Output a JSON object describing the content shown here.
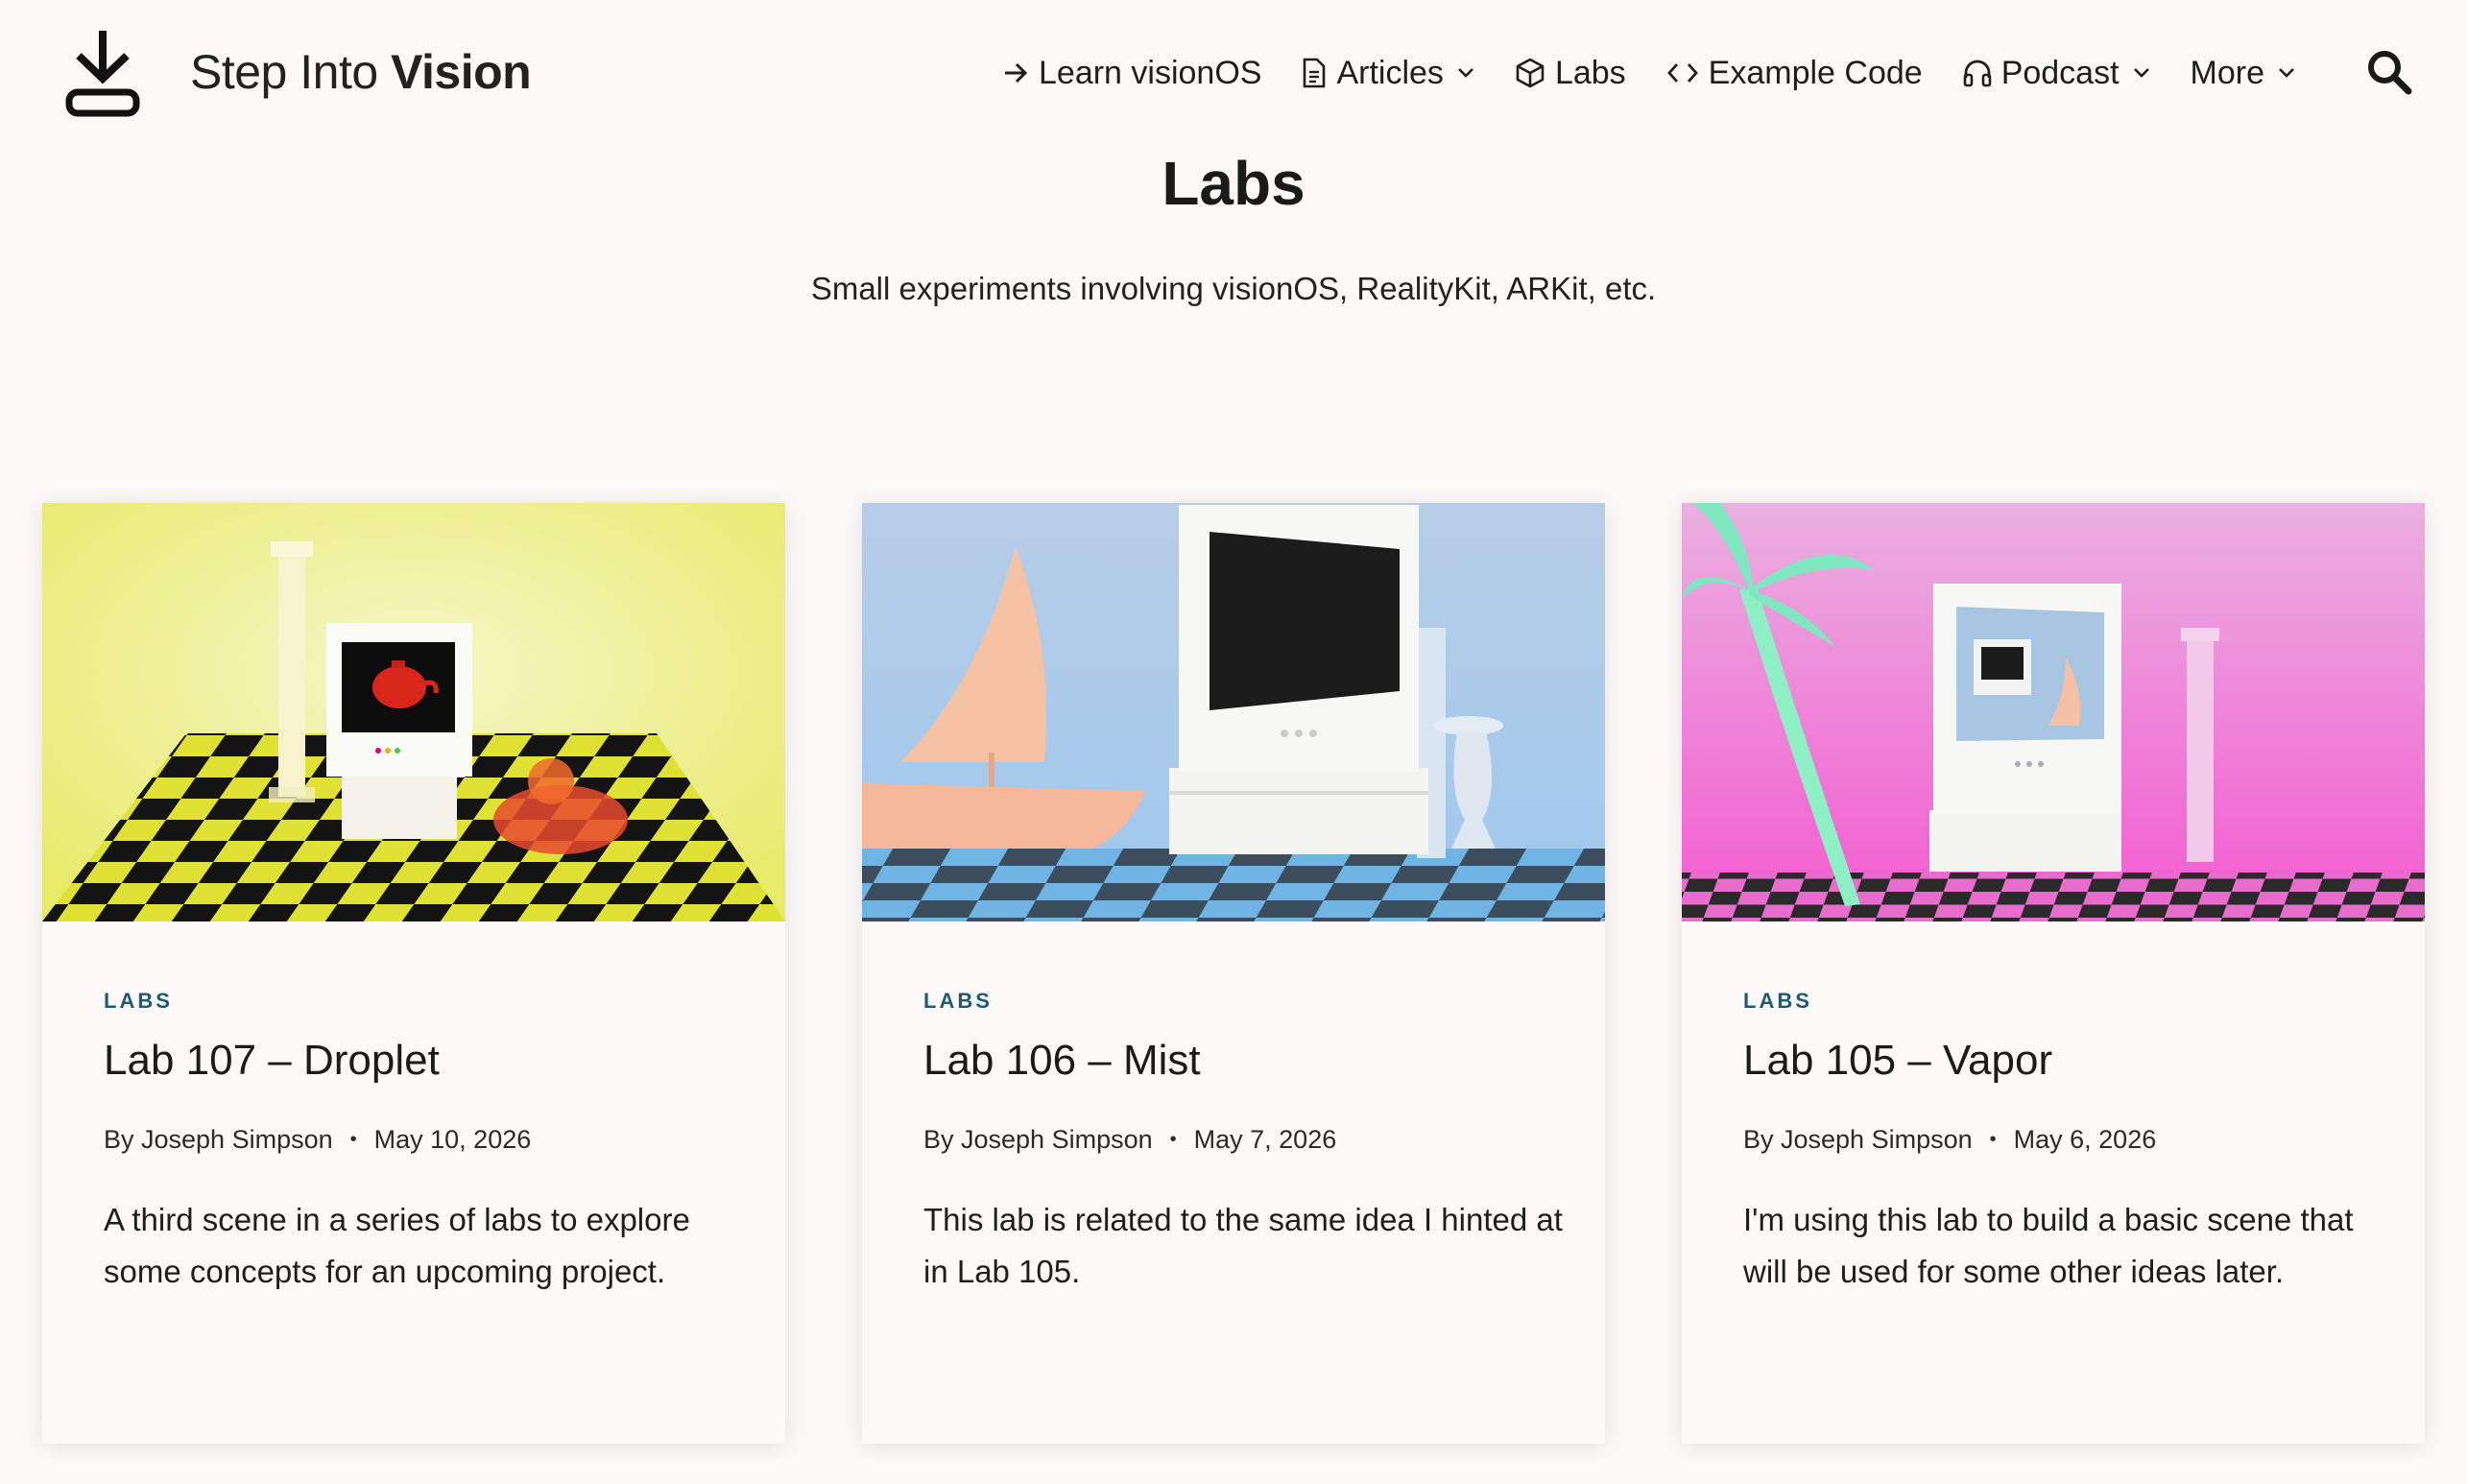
{
  "header": {
    "brand_light": "Step Into",
    "brand_bold": "Vision",
    "nav": [
      {
        "label": "Learn visionOS",
        "icon": "arrow-right-icon",
        "dropdown": false
      },
      {
        "label": "Articles",
        "icon": "document-icon",
        "dropdown": true
      },
      {
        "label": "Labs",
        "icon": "cube-icon",
        "dropdown": false
      },
      {
        "label": "Example Code",
        "icon": "code-icon",
        "dropdown": false
      },
      {
        "label": "Podcast",
        "icon": "headphones-icon",
        "dropdown": true
      },
      {
        "label": "More",
        "icon": "",
        "dropdown": true
      }
    ]
  },
  "page": {
    "title": "Labs",
    "subtitle": "Small experiments involving visionOS, RealityKit, ARKit, etc."
  },
  "cards": [
    {
      "category": "LABS",
      "title": "Lab 107 – Droplet",
      "author": "By Joseph Simpson",
      "date": "May 10, 2026",
      "excerpt": "A third scene in a series of labs to explore some concepts for an upcoming project.",
      "thumb_colors": {
        "sky": "#eef08c",
        "floor_a": "#d9de2f",
        "floor_b": "#141414"
      }
    },
    {
      "category": "LABS",
      "title": "Lab 106 – Mist",
      "author": "By Joseph Simpson",
      "date": "May 7, 2026",
      "excerpt": "This lab is related to the same idea I hinted at in Lab 105.",
      "thumb_colors": {
        "sky": "#a9cbec",
        "floor_a": "#6fb0df",
        "floor_b": "#3a4b5c"
      }
    },
    {
      "category": "LABS",
      "title": "Lab 105 – Vapor",
      "author": "By Joseph Simpson",
      "date": "May 6, 2026",
      "excerpt": "I'm using this lab to build a basic scene that will be used for some other ideas later.",
      "thumb_colors": {
        "sky": "#e99ad9",
        "floor_a": "#e366c9",
        "floor_b": "#2a2a2a"
      }
    }
  ],
  "colors": {
    "background": "#fcf9f8",
    "category": "#1e5b73",
    "text": "#1c1c1c"
  }
}
